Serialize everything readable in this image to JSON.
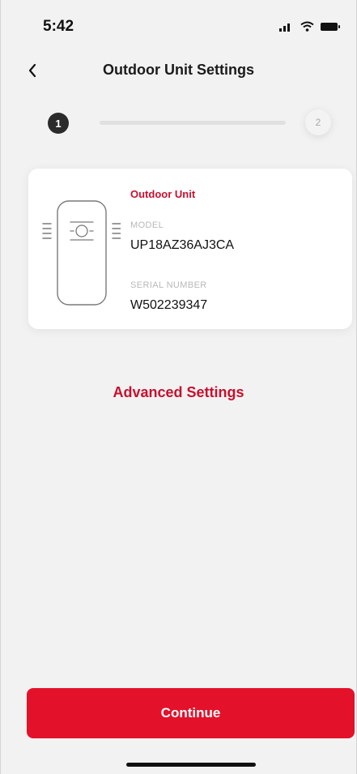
{
  "status_bar": {
    "time": "5:42",
    "icons": [
      "signal-icon",
      "wifi-icon",
      "battery-icon"
    ]
  },
  "nav": {
    "back_icon": "chevron-left-icon",
    "title": "Outdoor Unit Settings"
  },
  "stepper": {
    "current_step": "1",
    "next_step": "2",
    "progress": 0
  },
  "unit_card": {
    "label": "Outdoor Unit",
    "model_label": "MODEL",
    "model_value": "UP18AZ36AJ3CA",
    "serial_label": "SERIAL NUMBER",
    "serial_value": "W502239347",
    "illustration_icon": "outdoor-unit-icon"
  },
  "advanced_settings_link": "Advanced Settings",
  "continue_button": "Continue",
  "colors": {
    "accent_red": "#c8102e",
    "button_red": "#e4112b",
    "background": "#f2f2f2"
  }
}
